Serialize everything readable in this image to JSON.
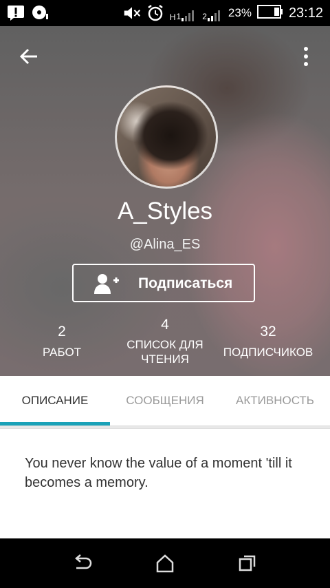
{
  "status_bar": {
    "battery_percent": "23%",
    "time": "23:12",
    "network_1": "H",
    "sim_1": "1",
    "sim_2": "2",
    "icons": [
      "alert-icon",
      "media-icon",
      "mute-icon",
      "alarm-icon",
      "signal-icon",
      "battery-icon"
    ]
  },
  "profile": {
    "display_name": "A_Styles",
    "handle": "@Alina_ES",
    "follow_label": "Подписаться",
    "stats": [
      {
        "value": "2",
        "label": "РАБОТ"
      },
      {
        "value": "4",
        "label": "СПИСОК ДЛЯ ЧТЕНИЯ"
      },
      {
        "value": "32",
        "label": "ПОДПИСЧИКОВ"
      }
    ]
  },
  "tabs": [
    {
      "label": "ОПИСАНИЕ",
      "active": true
    },
    {
      "label": "СООБЩЕНИЯ",
      "active": false
    },
    {
      "label": "АКТИВНОСТЬ",
      "active": false
    }
  ],
  "description": "You never know the value of a moment 'till it becomes a memory.",
  "colors": {
    "accent": "#1aa2b8",
    "status_bar": "#000000",
    "nav_bar": "#000000"
  }
}
